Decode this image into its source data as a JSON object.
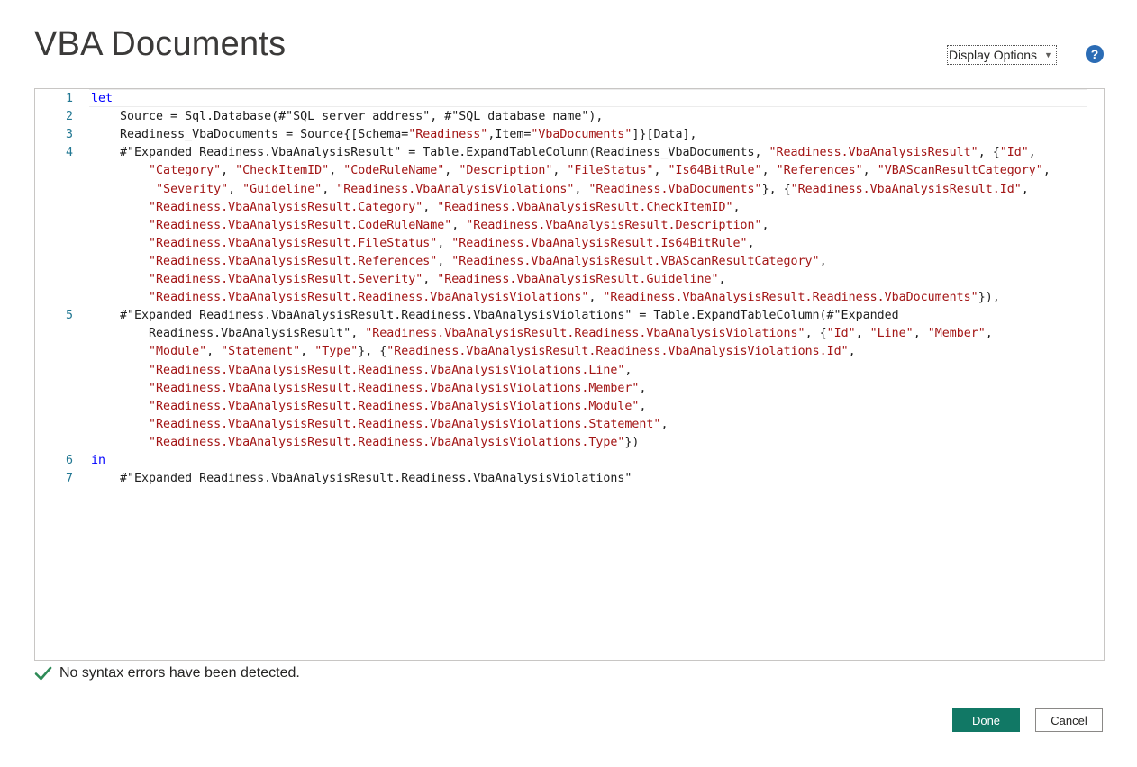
{
  "dialog": {
    "title": "VBA Documents",
    "display_options_label": "Display Options",
    "help_label": "?"
  },
  "editor": {
    "lines": [
      {
        "num": "1",
        "segments": [
          {
            "t": "let",
            "c": "kw"
          }
        ]
      },
      {
        "num": "2",
        "segments": [
          {
            "t": "    Source = Sql.Database(#\"SQL server address\", #\"SQL database name\"),",
            "c": ""
          }
        ]
      },
      {
        "num": "3",
        "segments": [
          {
            "t": "    Readiness_VbaDocuments = Source{[Schema=",
            "c": ""
          },
          {
            "t": "\"Readiness\"",
            "c": "str"
          },
          {
            "t": ",Item=",
            "c": ""
          },
          {
            "t": "\"VbaDocuments\"",
            "c": "str"
          },
          {
            "t": "]}[Data],",
            "c": ""
          }
        ]
      },
      {
        "num": "4",
        "segments": [
          {
            "t": "    #\"Expanded Readiness.VbaAnalysisResult\" = Table.ExpandTableColumn(Readiness_VbaDocuments, ",
            "c": ""
          },
          {
            "t": "\"Readiness.VbaAnalysisResult\"",
            "c": "str"
          },
          {
            "t": ", {",
            "c": ""
          },
          {
            "t": "\"Id\"",
            "c": "str"
          },
          {
            "t": ",",
            "c": ""
          }
        ]
      },
      {
        "num": "",
        "segments": [
          {
            "t": "        ",
            "c": ""
          },
          {
            "t": "\"Category\"",
            "c": "str"
          },
          {
            "t": ", ",
            "c": ""
          },
          {
            "t": "\"CheckItemID\"",
            "c": "str"
          },
          {
            "t": ", ",
            "c": ""
          },
          {
            "t": "\"CodeRuleName\"",
            "c": "str"
          },
          {
            "t": ", ",
            "c": ""
          },
          {
            "t": "\"Description\"",
            "c": "str"
          },
          {
            "t": ", ",
            "c": ""
          },
          {
            "t": "\"FileStatus\"",
            "c": "str"
          },
          {
            "t": ", ",
            "c": ""
          },
          {
            "t": "\"Is64BitRule\"",
            "c": "str"
          },
          {
            "t": ", ",
            "c": ""
          },
          {
            "t": "\"References\"",
            "c": "str"
          },
          {
            "t": ", ",
            "c": ""
          },
          {
            "t": "\"VBAScanResultCategory\"",
            "c": "str"
          },
          {
            "t": ",",
            "c": ""
          }
        ]
      },
      {
        "num": "",
        "segments": [
          {
            "t": "         ",
            "c": ""
          },
          {
            "t": "\"Severity\"",
            "c": "str"
          },
          {
            "t": ", ",
            "c": ""
          },
          {
            "t": "\"Guideline\"",
            "c": "str"
          },
          {
            "t": ", ",
            "c": ""
          },
          {
            "t": "\"Readiness.VbaAnalysisViolations\"",
            "c": "str"
          },
          {
            "t": ", ",
            "c": ""
          },
          {
            "t": "\"Readiness.VbaDocuments\"",
            "c": "str"
          },
          {
            "t": "}, {",
            "c": ""
          },
          {
            "t": "\"Readiness.VbaAnalysisResult.Id\"",
            "c": "str"
          },
          {
            "t": ",",
            "c": ""
          }
        ]
      },
      {
        "num": "",
        "segments": [
          {
            "t": "        ",
            "c": ""
          },
          {
            "t": "\"Readiness.VbaAnalysisResult.Category\"",
            "c": "str"
          },
          {
            "t": ", ",
            "c": ""
          },
          {
            "t": "\"Readiness.VbaAnalysisResult.CheckItemID\"",
            "c": "str"
          },
          {
            "t": ",",
            "c": ""
          }
        ]
      },
      {
        "num": "",
        "segments": [
          {
            "t": "        ",
            "c": ""
          },
          {
            "t": "\"Readiness.VbaAnalysisResult.CodeRuleName\"",
            "c": "str"
          },
          {
            "t": ", ",
            "c": ""
          },
          {
            "t": "\"Readiness.VbaAnalysisResult.Description\"",
            "c": "str"
          },
          {
            "t": ",",
            "c": ""
          }
        ]
      },
      {
        "num": "",
        "segments": [
          {
            "t": "        ",
            "c": ""
          },
          {
            "t": "\"Readiness.VbaAnalysisResult.FileStatus\"",
            "c": "str"
          },
          {
            "t": ", ",
            "c": ""
          },
          {
            "t": "\"Readiness.VbaAnalysisResult.Is64BitRule\"",
            "c": "str"
          },
          {
            "t": ",",
            "c": ""
          }
        ]
      },
      {
        "num": "",
        "segments": [
          {
            "t": "        ",
            "c": ""
          },
          {
            "t": "\"Readiness.VbaAnalysisResult.References\"",
            "c": "str"
          },
          {
            "t": ", ",
            "c": ""
          },
          {
            "t": "\"Readiness.VbaAnalysisResult.VBAScanResultCategory\"",
            "c": "str"
          },
          {
            "t": ",",
            "c": ""
          }
        ]
      },
      {
        "num": "",
        "segments": [
          {
            "t": "        ",
            "c": ""
          },
          {
            "t": "\"Readiness.VbaAnalysisResult.Severity\"",
            "c": "str"
          },
          {
            "t": ", ",
            "c": ""
          },
          {
            "t": "\"Readiness.VbaAnalysisResult.Guideline\"",
            "c": "str"
          },
          {
            "t": ",",
            "c": ""
          }
        ]
      },
      {
        "num": "",
        "segments": [
          {
            "t": "        ",
            "c": ""
          },
          {
            "t": "\"Readiness.VbaAnalysisResult.Readiness.VbaAnalysisViolations\"",
            "c": "str"
          },
          {
            "t": ", ",
            "c": ""
          },
          {
            "t": "\"Readiness.VbaAnalysisResult.Readiness.VbaDocuments\"",
            "c": "str"
          },
          {
            "t": "}),",
            "c": ""
          }
        ]
      },
      {
        "num": "5",
        "segments": [
          {
            "t": "    #\"Expanded Readiness.VbaAnalysisResult.Readiness.VbaAnalysisViolations\" = Table.ExpandTableColumn(#\"Expanded",
            "c": ""
          }
        ]
      },
      {
        "num": "",
        "segments": [
          {
            "t": "        Readiness.VbaAnalysisResult\", ",
            "c": ""
          },
          {
            "t": "\"Readiness.VbaAnalysisResult.Readiness.VbaAnalysisViolations\"",
            "c": "str"
          },
          {
            "t": ", {",
            "c": ""
          },
          {
            "t": "\"Id\"",
            "c": "str"
          },
          {
            "t": ", ",
            "c": ""
          },
          {
            "t": "\"Line\"",
            "c": "str"
          },
          {
            "t": ", ",
            "c": ""
          },
          {
            "t": "\"Member\"",
            "c": "str"
          },
          {
            "t": ",",
            "c": ""
          }
        ]
      },
      {
        "num": "",
        "segments": [
          {
            "t": "        ",
            "c": ""
          },
          {
            "t": "\"Module\"",
            "c": "str"
          },
          {
            "t": ", ",
            "c": ""
          },
          {
            "t": "\"Statement\"",
            "c": "str"
          },
          {
            "t": ", ",
            "c": ""
          },
          {
            "t": "\"Type\"",
            "c": "str"
          },
          {
            "t": "}, {",
            "c": ""
          },
          {
            "t": "\"Readiness.VbaAnalysisResult.Readiness.VbaAnalysisViolations.Id\"",
            "c": "str"
          },
          {
            "t": ",",
            "c": ""
          }
        ]
      },
      {
        "num": "",
        "segments": [
          {
            "t": "        ",
            "c": ""
          },
          {
            "t": "\"Readiness.VbaAnalysisResult.Readiness.VbaAnalysisViolations.Line\"",
            "c": "str"
          },
          {
            "t": ",",
            "c": ""
          }
        ]
      },
      {
        "num": "",
        "segments": [
          {
            "t": "        ",
            "c": ""
          },
          {
            "t": "\"Readiness.VbaAnalysisResult.Readiness.VbaAnalysisViolations.Member\"",
            "c": "str"
          },
          {
            "t": ",",
            "c": ""
          }
        ]
      },
      {
        "num": "",
        "segments": [
          {
            "t": "        ",
            "c": ""
          },
          {
            "t": "\"Readiness.VbaAnalysisResult.Readiness.VbaAnalysisViolations.Module\"",
            "c": "str"
          },
          {
            "t": ",",
            "c": ""
          }
        ]
      },
      {
        "num": "",
        "segments": [
          {
            "t": "        ",
            "c": ""
          },
          {
            "t": "\"Readiness.VbaAnalysisResult.Readiness.VbaAnalysisViolations.Statement\"",
            "c": "str"
          },
          {
            "t": ",",
            "c": ""
          }
        ]
      },
      {
        "num": "",
        "segments": [
          {
            "t": "        ",
            "c": ""
          },
          {
            "t": "\"Readiness.VbaAnalysisResult.Readiness.VbaAnalysisViolations.Type\"",
            "c": "str"
          },
          {
            "t": "})",
            "c": ""
          }
        ]
      },
      {
        "num": "6",
        "segments": [
          {
            "t": "in",
            "c": "kw"
          }
        ]
      },
      {
        "num": "7",
        "segments": [
          {
            "t": "    #\"Expanded Readiness.VbaAnalysisResult.Readiness.VbaAnalysisViolations\"",
            "c": ""
          }
        ]
      }
    ]
  },
  "status": {
    "message": "No syntax errors have been detected.",
    "icon": "check-icon",
    "color": "#2e8b57"
  },
  "buttons": {
    "done_label": "Done",
    "cancel_label": "Cancel",
    "accent": "#117865"
  }
}
